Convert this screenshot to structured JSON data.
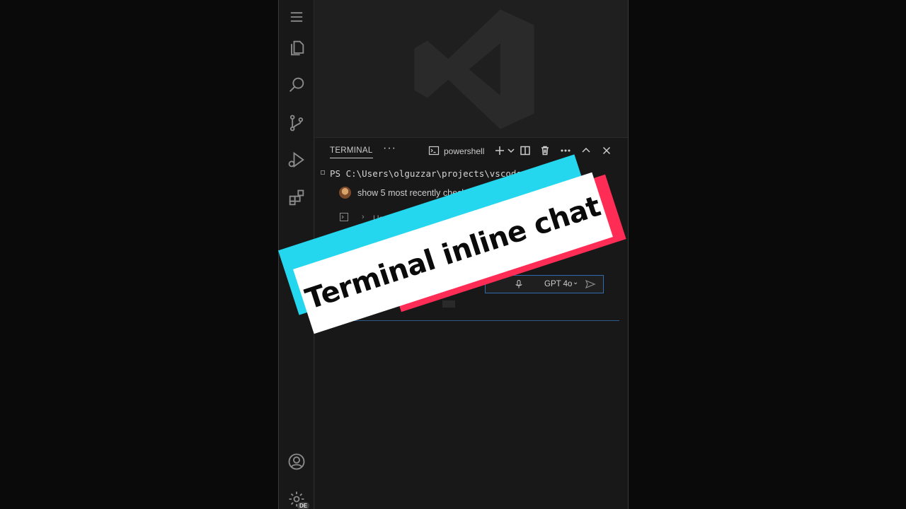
{
  "activity_bar": {
    "icons": [
      "menu-icon",
      "files-icon",
      "search-icon",
      "source-control-icon",
      "run-debug-icon",
      "extensions-icon",
      "account-icon",
      "settings-gear-icon"
    ],
    "settings_badge": "DE"
  },
  "panel": {
    "tab_label": "TERMINAL",
    "tab_more": "···",
    "shell_label": "powershell",
    "actions": [
      "new-terminal",
      "split",
      "kill",
      "more",
      "maximize",
      "close"
    ]
  },
  "terminal": {
    "prompt": "PS C:\\Users\\olguzzar\\projects\\vscode>"
  },
  "inline_chat": {
    "query": "show 5 most recently checked",
    "used_ref": "Used 1",
    "model": "GPT 4o"
  },
  "overlay": {
    "caption": "Terminal inline chat"
  },
  "colors": {
    "accent_blue": "#2f6bb0",
    "sticker_cyan": "#25d7ee",
    "sticker_pink": "#ff2c55"
  }
}
